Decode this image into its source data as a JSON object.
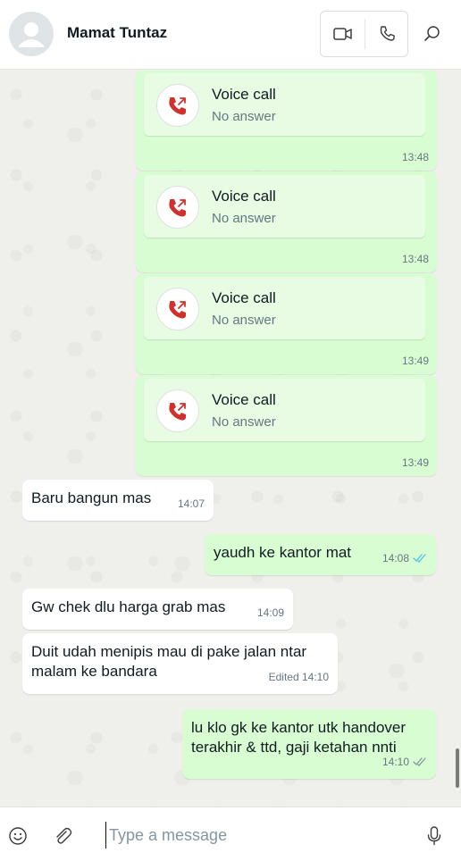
{
  "header": {
    "contact_name": "Mamat Tuntaz",
    "icons": [
      "avatar-icon",
      "video-call-icon",
      "voice-call-icon",
      "search-icon"
    ]
  },
  "calls": [
    {
      "title": "Voice call",
      "status": "No answer",
      "time": "13:48"
    },
    {
      "title": "Voice call",
      "status": "No answer",
      "time": "13:48"
    },
    {
      "title": "Voice call",
      "status": "No answer",
      "time": "13:49"
    },
    {
      "title": "Voice call",
      "status": "No answer",
      "time": "13:49"
    }
  ],
  "messages": [
    {
      "direction": "in",
      "text": "Baru bangun mas",
      "time": "14:07"
    },
    {
      "direction": "out",
      "text": "yaudh ke kantor mat",
      "time": "14:08",
      "read": true
    },
    {
      "direction": "in",
      "text": "Gw chek dlu harga grab  mas",
      "time": "14:09"
    },
    {
      "direction": "in",
      "text": "Duit udah menipis mau di pake jalan ntar\nmalam ke bandara",
      "time": "Edited 14:10"
    },
    {
      "direction": "out",
      "text": "lu klo gk ke kantor utk handover\nterakhir & ttd, gaji ketahan nnti",
      "time": "14:10",
      "read": false
    }
  ],
  "composer": {
    "placeholder": "Type a message",
    "icons": [
      "emoji-icon",
      "attach-icon",
      "microphone-icon"
    ]
  },
  "colors": {
    "outgoing_bubble": "#d9fdd3",
    "incoming_bubble": "#ffffff",
    "missed_call_red": "#d0312d",
    "read_tick_blue": "#53bdeb"
  }
}
